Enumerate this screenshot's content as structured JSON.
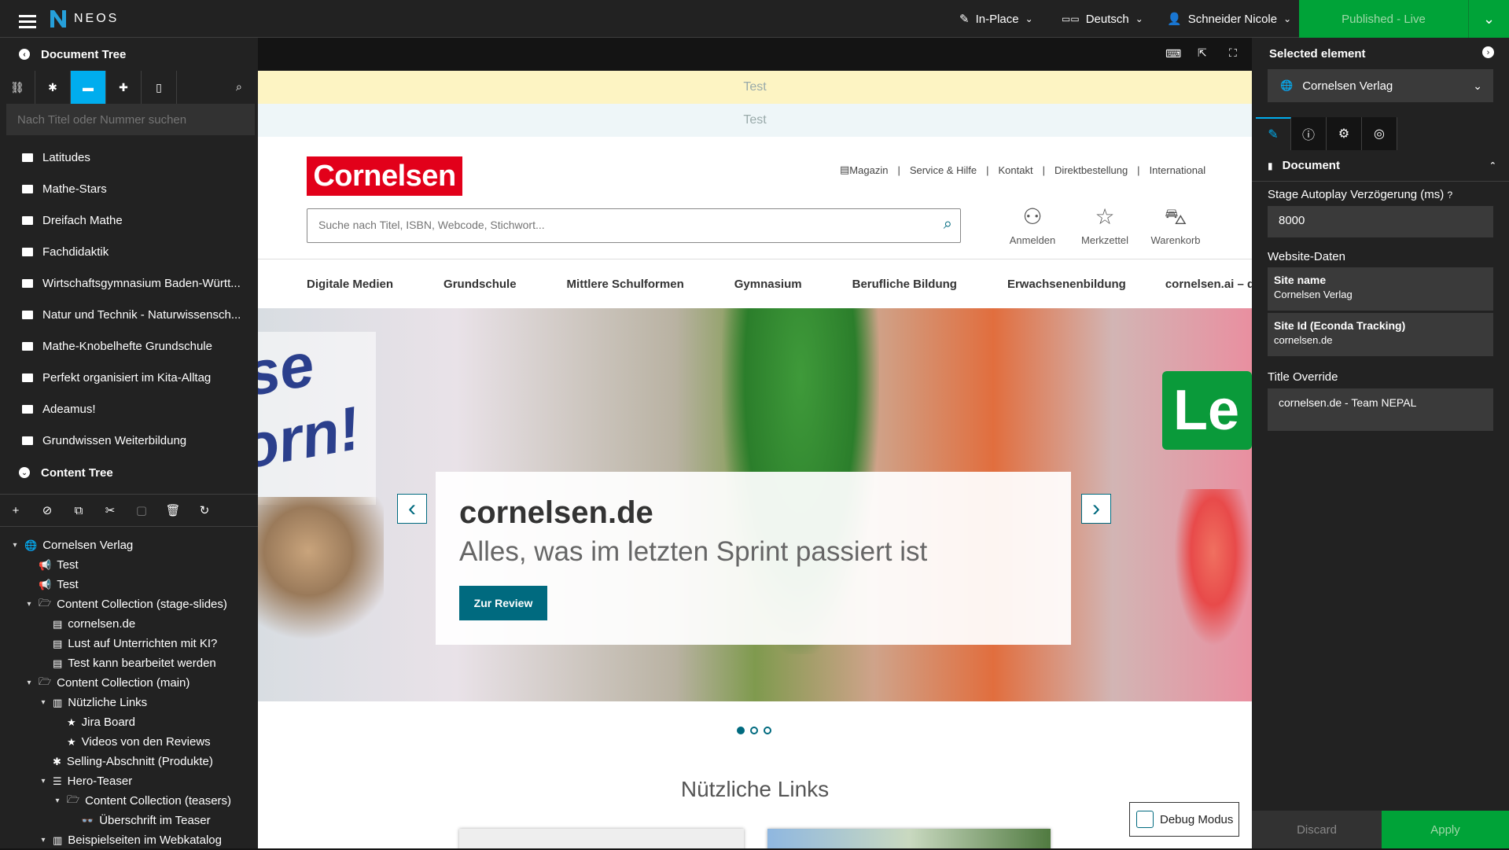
{
  "app": {
    "brand": "NEOS"
  },
  "topbar": {
    "mode": "In-Place",
    "language": "Deutsch",
    "user": "Schneider Nicole",
    "publish": "Published - Live"
  },
  "document_tree": {
    "title": "Document Tree",
    "search_placeholder": "Nach Titel oder Nummer suchen",
    "items": [
      "Latitudes",
      "Mathe-Stars",
      "Dreifach Mathe",
      "Fachdidaktik",
      "Wirtschaftsgymnasium Baden-Württ...",
      "Natur und Technik - Naturwissensch...",
      "Mathe-Knobelhefte Grundschule",
      "Perfekt organisiert im Kita-Alltag",
      "Adeamus!",
      "Grundwissen Weiterbildung"
    ]
  },
  "content_tree": {
    "title": "Content Tree",
    "items": [
      {
        "label": "Cornelsen Verlag",
        "level": 0,
        "toggle": "▾",
        "icon": "🌐"
      },
      {
        "label": "Test",
        "level": 1,
        "toggle": "",
        "icon": "📢"
      },
      {
        "label": "Test",
        "level": 1,
        "toggle": "",
        "icon": "📢"
      },
      {
        "label": "Content Collection (stage-slides)",
        "level": 1,
        "toggle": "▾",
        "icon": "🗁"
      },
      {
        "label": "cornelsen.de",
        "level": 2,
        "toggle": "",
        "icon": "▤"
      },
      {
        "label": "Lust auf Unterrichten mit KI?",
        "level": 2,
        "toggle": "",
        "icon": "▤"
      },
      {
        "label": "Test kann bearbeitet werden",
        "level": 2,
        "toggle": "",
        "icon": "▤"
      },
      {
        "label": "Content Collection (main)",
        "level": 1,
        "toggle": "▾",
        "icon": "🗁"
      },
      {
        "label": "Nützliche Links",
        "level": 2,
        "toggle": "▾",
        "icon": "▥"
      },
      {
        "label": "Jira Board",
        "level": 3,
        "toggle": "",
        "icon": "★"
      },
      {
        "label": "Videos von den Reviews",
        "level": 3,
        "toggle": "",
        "icon": "★"
      },
      {
        "label": "Selling-Abschnitt (Produkte)",
        "level": 2,
        "toggle": "",
        "icon": "✱"
      },
      {
        "label": "Hero-Teaser",
        "level": 2,
        "toggle": "▾",
        "icon": "☰"
      },
      {
        "label": "Content Collection (teasers)",
        "level": 3,
        "toggle": "▾",
        "icon": "🗁"
      },
      {
        "label": "Überschrift im Teaser",
        "level": 4,
        "toggle": "",
        "icon": "👓"
      },
      {
        "label": "Beispielseiten im Webkatalog",
        "level": 2,
        "toggle": "▾",
        "icon": "▥"
      }
    ]
  },
  "site": {
    "test_bar_1": "Test",
    "test_bar_2": "Test",
    "logo": "Cornelsen",
    "toplinks": [
      "Magazin",
      "Service & Hilfe",
      "Kontakt",
      "Direktbestellung",
      "International"
    ],
    "search_placeholder": "Suche nach Titel, ISBN, Webcode, Stichwort...",
    "account": [
      "Anmelden",
      "Merkzettel",
      "Warenkorb"
    ],
    "nav": [
      "Digitale Medien",
      "Grundschule",
      "Mittlere Schulformen",
      "Gymnasium",
      "Berufliche Bildung",
      "Erwachsenenbildung",
      "cornelsen.ai – die KI-Toolbox"
    ],
    "hero": {
      "title": "cornelsen.de",
      "subtitle": "Alles, was im letzten Sprint passiert ist",
      "button": "Zur Review",
      "banner_left": "ise\norn!",
      "banner_right": "Le"
    },
    "section_title": "Nützliche Links",
    "debug": "Debug Modus"
  },
  "inspector": {
    "title": "Selected element",
    "selected": "Cornelsen Verlag",
    "section": "Document",
    "autoplay_label": "Stage Autoplay Verzögerung (ms)",
    "autoplay_value": "8000",
    "website_label": "Website-Daten",
    "site_name_label": "Site name",
    "site_name_value": "Cornelsen Verlag",
    "site_id_label": "Site Id (Econda Tracking)",
    "site_id_value": "cornelsen.de",
    "title_override_label": "Title Override",
    "title_override_value": "cornelsen.de - Team NEPAL",
    "discard": "Discard",
    "apply": "Apply"
  },
  "colors": {
    "accent": "#00adee",
    "publish": "#00a338",
    "brand_red": "#e2001a",
    "teal": "#006a7f"
  }
}
